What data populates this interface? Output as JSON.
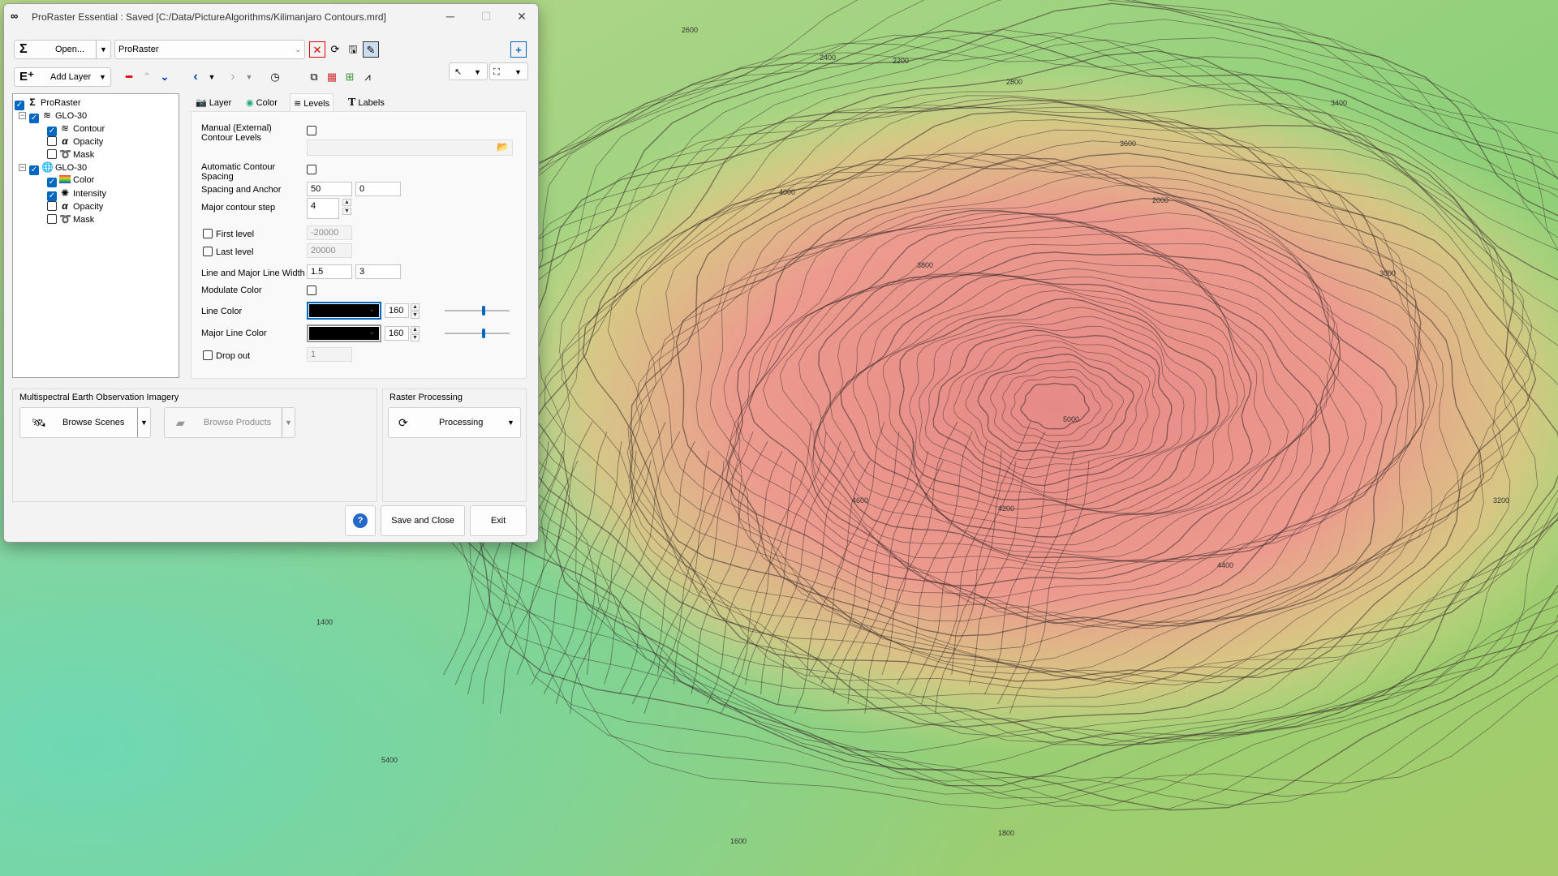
{
  "window": {
    "title": "ProRaster Essential : Saved [C:/Data/PictureAlgorithms/Kilimanjaro Contours.mrd]",
    "minimize": "─",
    "maximize": "☐",
    "close": "✕"
  },
  "toolbar": {
    "open_label": "Open...",
    "project_value": "ProRaster",
    "add_layer_label": "Add Layer"
  },
  "tree": {
    "root": "ProRaster",
    "layers": [
      {
        "name": "GLO-30",
        "children": [
          "Contour",
          "Opacity",
          "Mask"
        ]
      },
      {
        "name": "GLO-30",
        "children": [
          "Color",
          "Intensity",
          "Opacity",
          "Mask"
        ]
      }
    ]
  },
  "tabs": [
    "Layer",
    "Color",
    "Levels",
    "Labels"
  ],
  "levels": {
    "manual_label": "Manual (External)\nContour Levels",
    "auto_label": "Automatic Contour\nSpacing",
    "spacing_label": "Spacing and Anchor",
    "spacing": "50",
    "anchor": "0",
    "major_step_label": "Major contour step",
    "major_step": "4",
    "first_level_label": "First level",
    "first_level": "-20000",
    "last_level_label": "Last level",
    "last_level": "20000",
    "width_label": "Line and Major Line Width",
    "line_width": "1.5",
    "major_line_width": "3",
    "modulate_label": "Modulate Color",
    "line_color_label": "Line Color",
    "line_color": "#000000",
    "line_alpha": "160",
    "major_color_label": "Major Line Color",
    "major_color": "#000000",
    "major_alpha": "160",
    "dropout_label": "Drop out",
    "dropout": "1"
  },
  "groups": {
    "imagery_title": "Multispectral Earth Observation Imagery",
    "browse_scenes": "Browse Scenes",
    "browse_products": "Browse Products",
    "raster_title": "Raster Processing",
    "processing": "Processing"
  },
  "footer": {
    "help": "?",
    "save_close": "Save and Close",
    "exit": "Exit"
  },
  "map_labels": [
    "2600",
    "2400",
    "2200",
    "2800",
    "2000",
    "3000",
    "3200",
    "3400",
    "3600",
    "3800",
    "4000",
    "4200",
    "4400",
    "4600",
    "5000",
    "5400",
    "1800",
    "1600",
    "1400"
  ]
}
